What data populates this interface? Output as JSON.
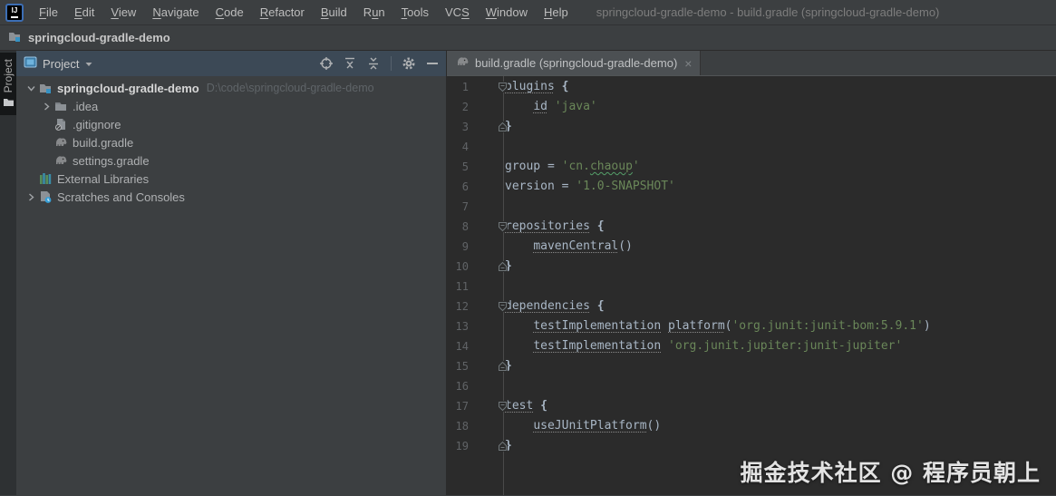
{
  "window_title": "springcloud-gradle-demo - build.gradle (springcloud-gradle-demo)",
  "logo_text": "IJ",
  "menu": {
    "items": [
      {
        "label": "File",
        "m": 0
      },
      {
        "label": "Edit",
        "m": 0
      },
      {
        "label": "View",
        "m": 0
      },
      {
        "label": "Navigate",
        "m": 0
      },
      {
        "label": "Code",
        "m": 0
      },
      {
        "label": "Refactor",
        "m": 0
      },
      {
        "label": "Build",
        "m": 0
      },
      {
        "label": "Run",
        "m": 1
      },
      {
        "label": "Tools",
        "m": 0
      },
      {
        "label": "VCS",
        "m": 2
      },
      {
        "label": "Window",
        "m": 0
      },
      {
        "label": "Help",
        "m": 0
      }
    ]
  },
  "breadcrumb": {
    "project": "springcloud-gradle-demo"
  },
  "tool_stripe": {
    "project_label": "Project"
  },
  "project_panel": {
    "title": "Project",
    "toolbar": [
      {
        "icon": "locate"
      },
      {
        "icon": "expand-all"
      },
      {
        "icon": "collapse-all"
      },
      {
        "icon": "separator"
      },
      {
        "icon": "gear"
      },
      {
        "icon": "minimize"
      }
    ],
    "tree": [
      {
        "label": "springcloud-gradle-demo",
        "path": "D:\\code\\springcloud-gradle-demo",
        "icon": "folder-project",
        "chevron": "down",
        "indent": 0,
        "root": true
      },
      {
        "label": ".idea",
        "icon": "folder",
        "chevron": "right",
        "indent": 1
      },
      {
        "label": ".gitignore",
        "icon": "gitignore",
        "indent": 1
      },
      {
        "label": "build.gradle",
        "icon": "gradle",
        "indent": 1
      },
      {
        "label": "settings.gradle",
        "icon": "gradle",
        "indent": 1
      },
      {
        "label": "External Libraries",
        "icon": "libraries",
        "indent": 0
      },
      {
        "label": "Scratches and Consoles",
        "icon": "scratches",
        "chevron": "right",
        "indent": 0
      }
    ]
  },
  "editor": {
    "tab": {
      "label": "build.gradle (springcloud-gradle-demo)",
      "close": "×",
      "icon": "gradle"
    },
    "lines": [
      {
        "n": 1,
        "fold": "start",
        "seg": [
          [
            "plugins",
            "u"
          ],
          [
            " {",
            "b"
          ]
        ]
      },
      {
        "n": 2,
        "seg": [
          [
            "    ",
            "p"
          ],
          [
            "id",
            "u"
          ],
          [
            " ",
            "p"
          ],
          [
            "'java'",
            "s"
          ]
        ]
      },
      {
        "n": 3,
        "fold": "end",
        "seg": [
          [
            "}",
            "b"
          ]
        ]
      },
      {
        "n": 4,
        "seg": []
      },
      {
        "n": 5,
        "seg": [
          [
            "group = ",
            "p"
          ],
          [
            "'cn.",
            "s"
          ],
          [
            "chaoup",
            "sw"
          ],
          [
            "'",
            "s"
          ]
        ]
      },
      {
        "n": 6,
        "seg": [
          [
            "version = ",
            "p"
          ],
          [
            "'1.0-SNAPSHOT'",
            "s"
          ]
        ]
      },
      {
        "n": 7,
        "seg": []
      },
      {
        "n": 8,
        "fold": "start",
        "seg": [
          [
            "repositories",
            "u"
          ],
          [
            " {",
            "b"
          ]
        ]
      },
      {
        "n": 9,
        "seg": [
          [
            "    ",
            "p"
          ],
          [
            "mavenCentral",
            "u"
          ],
          [
            "()",
            "p"
          ]
        ]
      },
      {
        "n": 10,
        "fold": "end",
        "seg": [
          [
            "}",
            "b"
          ]
        ]
      },
      {
        "n": 11,
        "seg": []
      },
      {
        "n": 12,
        "fold": "start",
        "seg": [
          [
            "dependencies",
            "u"
          ],
          [
            " {",
            "b"
          ]
        ]
      },
      {
        "n": 13,
        "seg": [
          [
            "    ",
            "p"
          ],
          [
            "testImplementation",
            "u"
          ],
          [
            " ",
            "p"
          ],
          [
            "platform",
            "u"
          ],
          [
            "(",
            "p"
          ],
          [
            "'org.junit:junit-bom:5.9.1'",
            "s"
          ],
          [
            ")",
            "p"
          ]
        ]
      },
      {
        "n": 14,
        "seg": [
          [
            "    ",
            "p"
          ],
          [
            "testImplementation",
            "u"
          ],
          [
            " ",
            "p"
          ],
          [
            "'org.junit.jupiter:junit-jupiter'",
            "s"
          ]
        ]
      },
      {
        "n": 15,
        "fold": "end",
        "seg": [
          [
            "}",
            "b"
          ]
        ]
      },
      {
        "n": 16,
        "seg": []
      },
      {
        "n": 17,
        "fold": "start",
        "seg": [
          [
            "test",
            "u"
          ],
          [
            " {",
            "b"
          ]
        ]
      },
      {
        "n": 18,
        "seg": [
          [
            "    ",
            "p"
          ],
          [
            "useJUnitPlatform",
            "u"
          ],
          [
            "()",
            "p"
          ]
        ]
      },
      {
        "n": 19,
        "fold": "end",
        "seg": [
          [
            "}",
            "b"
          ]
        ]
      }
    ]
  },
  "watermark": "掘金技术社区 @ 程序员朝上",
  "colors": {
    "editor_bg": "#2B2B2B",
    "panel_bg": "#3C3F41",
    "panel_header_bg": "#3C4956",
    "string_green": "#6A8759",
    "identifier_gray": "#A9B7C6",
    "line_number_gray": "#606366",
    "accent_blue": "#3592C4"
  }
}
